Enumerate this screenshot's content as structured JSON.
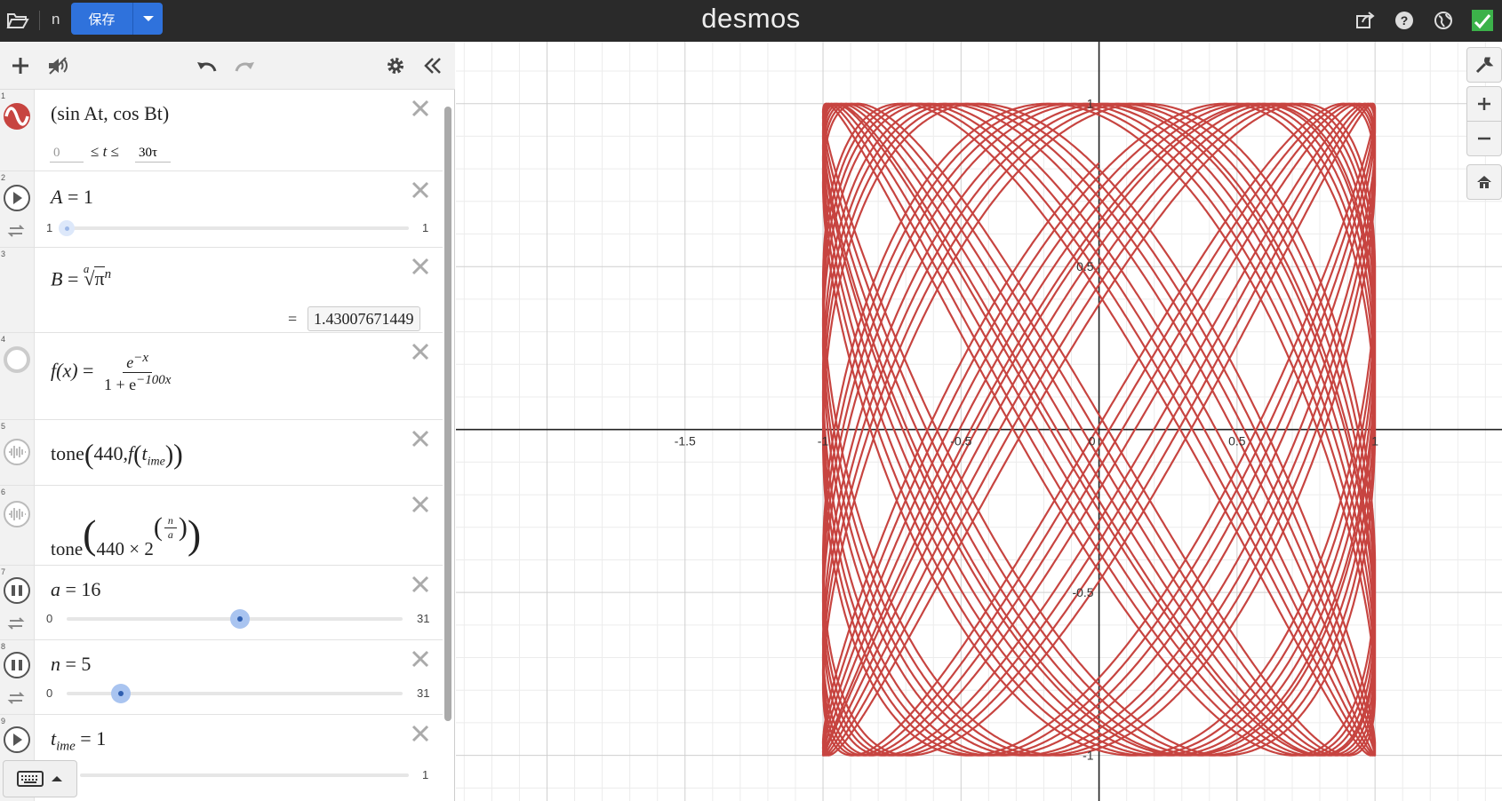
{
  "app": {
    "name": "desmos",
    "graph_name": "n",
    "save_label": "保存"
  },
  "icons": {
    "open": "folder-open-icon",
    "share": "share-icon",
    "help": "help-icon",
    "globe": "globe-icon",
    "user": "user-icon"
  },
  "panel": {
    "expressions": [
      {
        "id": "1",
        "latex": "(sin At, cos Bt)",
        "t_min": "0",
        "t_max": "30τ",
        "t_var": "t",
        "color": "#c74440"
      },
      {
        "id": "2",
        "var": "A",
        "value": "1",
        "slider_min": "1",
        "slider_max": "1"
      },
      {
        "id": "3",
        "lhs": "B",
        "index": "a",
        "radicand": "π",
        "power": "n",
        "result": "1.43007671449"
      },
      {
        "id": "4",
        "lhs": "f(x)",
        "num_base": "e",
        "num_exp": "−x",
        "den_base": "1 + e",
        "den_exp": "−100x"
      },
      {
        "id": "5",
        "fn": "tone",
        "arg1": "440",
        "arg2_fn": "f",
        "arg2_var": "t",
        "arg2_sub": "ime"
      },
      {
        "id": "6",
        "fn": "tone",
        "base": "440 × 2",
        "frac_num": "n",
        "frac_den": "a"
      },
      {
        "id": "7",
        "var": "a",
        "value": "16",
        "slider_min": "0",
        "slider_max": "31",
        "slider_fraction": 0.516
      },
      {
        "id": "8",
        "var": "n",
        "value": "5",
        "slider_min": "0",
        "slider_max": "31",
        "slider_fraction": 0.161
      },
      {
        "id": "9",
        "var": "t",
        "sub": "ime",
        "value": "1",
        "slider_max": "1"
      }
    ]
  },
  "chart_data": {
    "type": "line",
    "title": "",
    "xlabel": "",
    "ylabel": "",
    "xlim": [
      -2.33,
      1.46
    ],
    "ylim": [
      -1.14,
      1.19
    ],
    "x_ticks": [
      "-1.5",
      "-1",
      "-0.5",
      "0",
      "0.5",
      "1"
    ],
    "y_ticks": [
      "1",
      "0.5",
      "-0.5",
      "-1"
    ],
    "grid": true,
    "series": [
      {
        "x_expr": "sin(A t)",
        "y_expr": "cos(B t)",
        "A": 1,
        "B": 1.43007671449,
        "t_range": [
          0,
          188.4956
        ],
        "color": "#c74440"
      }
    ]
  }
}
